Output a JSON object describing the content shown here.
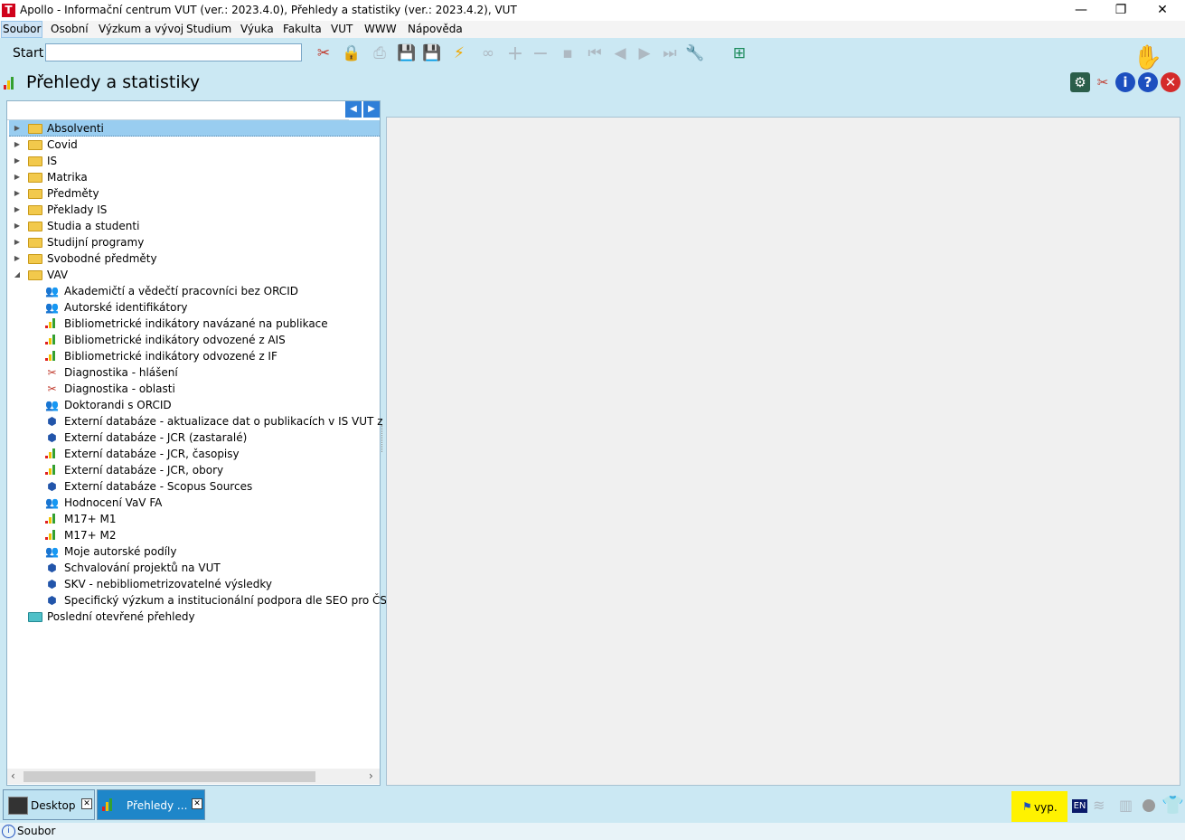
{
  "window": {
    "title": "Apollo - Informační centrum VUT  (ver.: 2023.4.0), Přehledy a statistiky (ver.: 2023.4.2), VUT",
    "app_icon_letter": "T",
    "controls": {
      "minimize": "—",
      "restore": "❐",
      "close": "✕"
    }
  },
  "menu": [
    {
      "label": "Soubor",
      "selected": true
    },
    {
      "label": "Osobní"
    },
    {
      "label": "Výzkum a vývoj"
    },
    {
      "label": "Studium"
    },
    {
      "label": "Výuka"
    },
    {
      "label": "Fakulta"
    },
    {
      "label": "VUT"
    },
    {
      "label": "WWW"
    },
    {
      "label": "Nápověda"
    }
  ],
  "toolbar": {
    "start_label": "Start",
    "start_value": ""
  },
  "page": {
    "title": "Přehledy a statistiky"
  },
  "tree": {
    "filter_value": "",
    "items": [
      {
        "label": "Absolventi",
        "type": "folder",
        "expanded": false,
        "selected": true
      },
      {
        "label": "Covid",
        "type": "folder"
      },
      {
        "label": "IS",
        "type": "folder"
      },
      {
        "label": "Matrika",
        "type": "folder"
      },
      {
        "label": "Předměty",
        "type": "folder"
      },
      {
        "label": "Překlady IS",
        "type": "folder"
      },
      {
        "label": "Studia a studenti",
        "type": "folder"
      },
      {
        "label": "Studijní programy",
        "type": "folder"
      },
      {
        "label": "Svobodné předměty",
        "type": "folder"
      },
      {
        "label": "VAV",
        "type": "folder",
        "expanded": true
      },
      {
        "label": "Akademičtí a vědečtí pracovníci bez ORCID",
        "type": "people"
      },
      {
        "label": "Autorské identifikátory",
        "type": "people"
      },
      {
        "label": "Bibliometrické indikátory navázané na publikace",
        "type": "bars"
      },
      {
        "label": "Bibliometrické indikátory odvozené z AIS",
        "type": "bars"
      },
      {
        "label": "Bibliometrické indikátory odvozené z IF",
        "type": "bars"
      },
      {
        "label": "Diagnostika - hlášení",
        "type": "tools"
      },
      {
        "label": "Diagnostika - oblasti",
        "type": "tools"
      },
      {
        "label": "Doktorandi s ORCID",
        "type": "people"
      },
      {
        "label": "Externí databáze - aktualizace dat o publikacích v IS VUT z WoS",
        "type": "cube"
      },
      {
        "label": "Externí databáze - JCR (zastaralé)",
        "type": "cube"
      },
      {
        "label": "Externí databáze - JCR, časopisy",
        "type": "bars"
      },
      {
        "label": "Externí databáze - JCR, obory",
        "type": "bars"
      },
      {
        "label": "Externí databáze - Scopus Sources",
        "type": "cube"
      },
      {
        "label": "Hodnocení VaV FA",
        "type": "people"
      },
      {
        "label": "M17+ M1",
        "type": "bars"
      },
      {
        "label": "M17+ M2",
        "type": "bars"
      },
      {
        "label": "Moje autorské podíly",
        "type": "people"
      },
      {
        "label": "Schvalování projektů na VUT",
        "type": "cube"
      },
      {
        "label": "SKV - nebibliometrizovatelné výsledky",
        "type": "cube"
      },
      {
        "label": "Specifický výzkum a institucionální podpora dle SEO pro ČSÚ",
        "type": "cube"
      },
      {
        "label": "Poslední otevřené přehledy",
        "type": "recent"
      }
    ]
  },
  "taskbar": {
    "tasks": [
      {
        "label": "Desktop",
        "active": false
      },
      {
        "label": "Přehledy ...",
        "active": true
      }
    ],
    "vyp_label": "vyp.",
    "lang_label": "EN"
  },
  "status": {
    "text": "Soubor"
  }
}
